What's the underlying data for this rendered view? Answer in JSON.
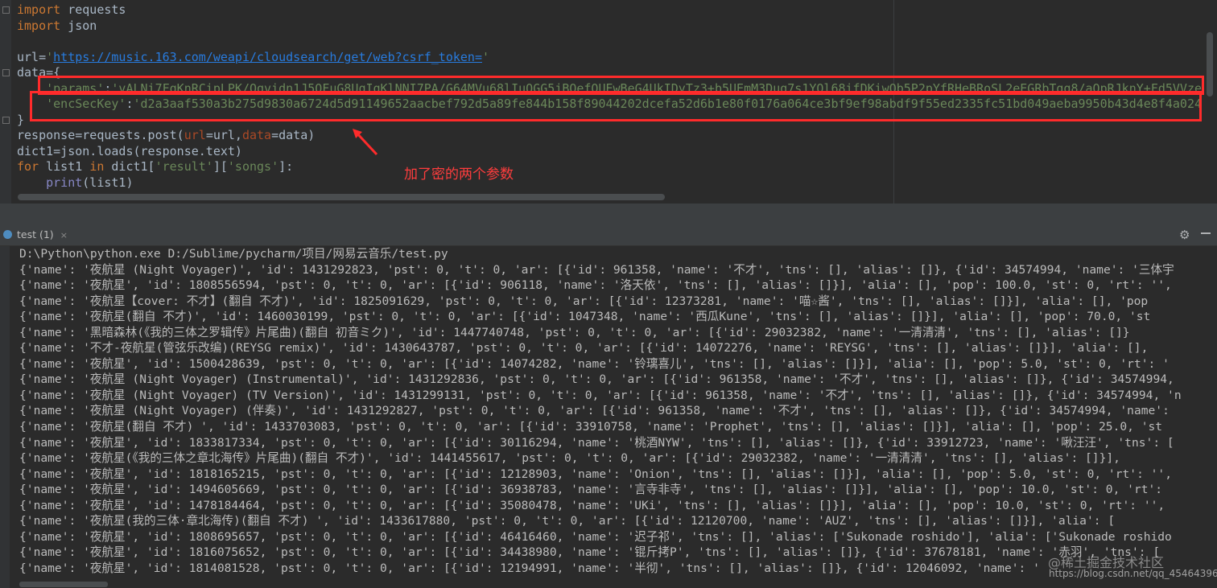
{
  "editor": {
    "lines": [
      {
        "k": "import",
        "r": " requests"
      },
      {
        "k": "import",
        "r": " json"
      },
      {
        "blank": true
      },
      {
        "pre": "url=",
        "s": "'",
        "u": "https://music.163.com/weapi/cloudsearch/get/web?csrf_token=",
        "e": "'"
      },
      {
        "pre": "data={"
      },
      {
        "ind": "    ",
        "s": "'params'",
        "r": ":",
        "v": "'vALNi7FqKnRCipLPK/Oqvidn1J5QFuG8UqIqKlNNI7PA/G64MVu68lIuQGG5jBOefOUEwBeG4UkIDyTz3+b5UEmM3Dug7s1YOl68ifDKiwQb5P2pYfRHeBRoSL2eEGRbTgq8/aOpRJknY+Fd5VVze8!"
      },
      {
        "ind": "    ",
        "s": "'encSecKey'",
        "r": ":",
        "v": "'d2a3aaf530a3b275d9830a6724d5d91149652aacbef792d5a89fe844b158f89044202dcefa52d6b1e80f0176a064ce3bf9ef98abdf9f55ed2335fc51bd049aeba9950b43d4e8f4a024"
      },
      {
        "pre": "}"
      },
      {
        "pre": "response=requests.post(",
        "p1": "url",
        "m1": "=url,",
        "p2": "data",
        "m2": "=data)"
      },
      {
        "pre": "dict1=json.loads(response.text)"
      },
      {
        "k": "for",
        "r": " list1 ",
        "k2": "in",
        "r2": " dict1[",
        "s2": "'result'",
        "r3": "][",
        "s3": "'songs'",
        "r4": "]:"
      },
      {
        "ind": "    ",
        "fn": "print",
        "r": "(list1)"
      }
    ]
  },
  "annotation": {
    "note": "加了密的两个参数",
    "color": "#ff2b2b"
  },
  "run_panel": {
    "tab_label": "test (1)",
    "close_glyph": "×",
    "gear_glyph": "⚙",
    "command": "D:\\Python\\python.exe D:/Sublime/pycharm/项目/网易云音乐/test.py",
    "output": [
      "{'name': '夜航星 (Night Voyager)', 'id': 1431292823, 'pst': 0, 't': 0, 'ar': [{'id': 961358, 'name': '不才', 'tns': [], 'alias': []}, {'id': 34574994, 'name': '三体宇",
      "{'name': '夜航星', 'id': 1808556594, 'pst': 0, 't': 0, 'ar': [{'id': 906118, 'name': '洛天依', 'tns': [], 'alias': []}], 'alia': [], 'pop': 100.0, 'st': 0, 'rt': '',",
      "{'name': '夜航星【cover: 不才】(翻自 不才)', 'id': 1825091629, 'pst': 0, 't': 0, 'ar': [{'id': 12373281, 'name': '喵☆酱', 'tns': [], 'alias': []}], 'alia': [], 'pop",
      "{'name': '夜航星(翻自 不才)', 'id': 1460030199, 'pst': 0, 't': 0, 'ar': [{'id': 1047348, 'name': '西瓜Kune', 'tns': [], 'alias': []}], 'alia': [], 'pop': 70.0, 'st",
      "{'name': '黑暗森林(《我的三体之罗辑传》片尾曲)(翻自 初音ミク)', 'id': 1447740748, 'pst': 0, 't': 0, 'ar': [{'id': 29032382, 'name': '一清清清', 'tns': [], 'alias': []}",
      "{'name': '不才-夜航星(管弦乐改编)(REYSG remix)', 'id': 1430643787, 'pst': 0, 't': 0, 'ar': [{'id': 14072276, 'name': 'REYSG', 'tns': [], 'alias': []}], 'alia': [],",
      "{'name': '夜航星', 'id': 1500428639, 'pst': 0, 't': 0, 'ar': [{'id': 14074282, 'name': '铃璃喜儿', 'tns': [], 'alias': []}], 'alia': [], 'pop': 5.0, 'st': 0, 'rt': '",
      "{'name': '夜航星 (Night Voyager) (Instrumental)', 'id': 1431292836, 'pst': 0, 't': 0, 'ar': [{'id': 961358, 'name': '不才', 'tns': [], 'alias': []}, {'id': 34574994,",
      "{'name': '夜航星 (Night Voyager) (TV Version)', 'id': 1431299131, 'pst': 0, 't': 0, 'ar': [{'id': 961358, 'name': '不才', 'tns': [], 'alias': []}, {'id': 34574994, 'n",
      "{'name': '夜航星 (Night Voyager) (伴奏)', 'id': 1431292827, 'pst': 0, 't': 0, 'ar': [{'id': 961358, 'name': '不才', 'tns': [], 'alias': []}, {'id': 34574994, 'name':",
      "{'name': '夜航星(翻自 不才) ', 'id': 1433703083, 'pst': 0, 't': 0, 'ar': [{'id': 33910758, 'name': 'Prophet', 'tns': [], 'alias': []}], 'alia': [], 'pop': 25.0, 'st",
      "{'name': '夜航星', 'id': 1833817334, 'pst': 0, 't': 0, 'ar': [{'id': 30116294, 'name': '桃酒NYW', 'tns': [], 'alias': []}, {'id': 33912723, 'name': '啾汪汪', 'tns': [",
      "{'name': '夜航星(《我的三体之章北海传》片尾曲)(翻自 不才)', 'id': 1441455617, 'pst': 0, 't': 0, 'ar': [{'id': 29032382, 'name': '一清清清', 'tns': [], 'alias': []}],",
      "{'name': '夜航星', 'id': 1818165215, 'pst': 0, 't': 0, 'ar': [{'id': 12128903, 'name': 'Onion', 'tns': [], 'alias': []}], 'alia': [], 'pop': 5.0, 'st': 0, 'rt': '',",
      "{'name': '夜航星', 'id': 1494605669, 'pst': 0, 't': 0, 'ar': [{'id': 36938783, 'name': '言寺非寺', 'tns': [], 'alias': []}], 'alia': [], 'pop': 10.0, 'st': 0, 'rt':",
      "{'name': '夜航星', 'id': 1478184464, 'pst': 0, 't': 0, 'ar': [{'id': 35080478, 'name': 'UKi', 'tns': [], 'alias': []}], 'alia': [], 'pop': 10.0, 'st': 0, 'rt': '',",
      "{'name': '夜航星(我的三体·章北海传)(翻自 不才) ', 'id': 1433617880, 'pst': 0, 't': 0, 'ar': [{'id': 12120700, 'name': 'AUZ', 'tns': [], 'alias': []}], 'alia': [",
      "{'name': '夜航星', 'id': 1808695657, 'pst': 0, 't': 0, 'ar': [{'id': 46416460, 'name': '迟子祁', 'tns': [], 'alias': ['Sukonade roshido'], 'alia': ['Sukonade roshido",
      "{'name': '夜航星', 'id': 1816075652, 'pst': 0, 't': 0, 'ar': [{'id': 34438980, 'name': '锟斤拷P', 'tns': [], 'alias': []}, {'id': 37678181, 'name': '赤羽', 'tns': [",
      "{'name': '夜航星', 'id': 1814081528, 'pst': 0, 't': 0, 'ar': [{'id': 12194991, 'name': '半彻', 'tns': [], 'alias': []}, {'id': 12046092, 'name': '"
    ]
  },
  "watermark": {
    "text": "@稀土掘金技术社区",
    "url": "https://blog.csdn.net/qq_45464396"
  }
}
